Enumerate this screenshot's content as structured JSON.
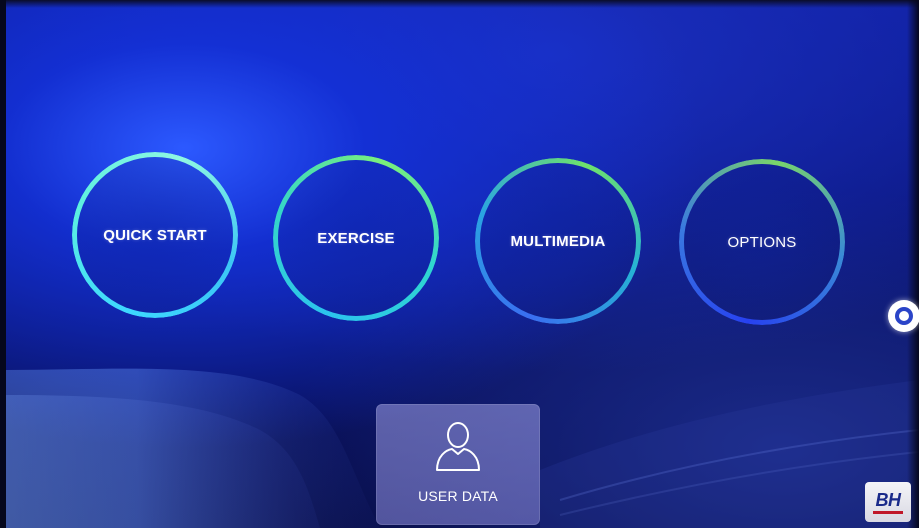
{
  "menu": {
    "items": [
      {
        "label": "QUICK START"
      },
      {
        "label": "EXERCISE"
      },
      {
        "label": "MULTIMEDIA"
      },
      {
        "label": "OPTIONS"
      }
    ]
  },
  "user_data": {
    "label": "USER DATA",
    "icon": "user-icon"
  },
  "brand": {
    "logo_text": "BH"
  },
  "pager": {
    "icon": "page-indicator-dot"
  },
  "colors": {
    "background_primary": "#1a2fbf",
    "background_dark": "#070c44",
    "ring_cyan": "#3dd8ff",
    "ring_green": "#7bf07a",
    "ring_blue": "#2741f0",
    "card": "#8c8cd2",
    "logo_text": "#1a2a8a",
    "logo_accent": "#c0182a"
  }
}
